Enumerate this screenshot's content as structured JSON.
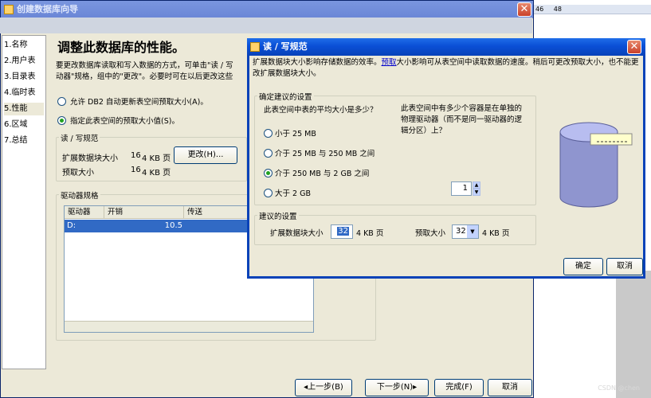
{
  "background": {
    "strip_values": [
      "46",
      "48"
    ],
    "watermark": "CSDN @chen"
  },
  "wizard": {
    "title": "创建数据库向导",
    "nav_items": [
      {
        "num": "1.",
        "label": "名称"
      },
      {
        "num": "2.",
        "label": "用户表"
      },
      {
        "num": "3.",
        "label": "目录表"
      },
      {
        "num": "4.",
        "label": "临时表"
      },
      {
        "num": "5.",
        "label": "性能"
      },
      {
        "num": "6.",
        "label": "区域"
      },
      {
        "num": "7.",
        "label": "总结"
      }
    ],
    "heading": "调整此数据库的性能。",
    "desc_line1": "要更改数据库读取和写入数据的方式，可单击\"读 / 写",
    "desc_line2": "动器\"规格，组中的\"更改\"。必要时可在以后更改这些",
    "radio_auto": "允许 DB2 自动更新表空间预取大小(A)。",
    "radio_specify": "指定此表空间的预取大小值(S)。",
    "rw_group_label": "读 / 写规范",
    "extent_label": "扩展数据块大小",
    "extent_value": "16",
    "extent_unit": "4 KB 页",
    "prefetch_label": "预取大小",
    "prefetch_value": "16",
    "prefetch_unit": "4 KB 页",
    "change_button": "更改(H)...",
    "drive_group_label": "驱动器规格",
    "table_headers": [
      "驱动器",
      "开销",
      "传送"
    ],
    "table_rows": [
      [
        "D:",
        "10.5",
        ""
      ]
    ],
    "back_button": "◂上一步(B)",
    "next_button": "下一步(N)▸",
    "finish_button": "完成(F)",
    "cancel_button": "取消"
  },
  "dialog": {
    "title": "读 / 写规范",
    "info_pre": "扩展数据块大小影响存储数据的效率。",
    "info_link": "预取",
    "info_post": "大小影响可从表空间中读取数据的速度。稍后可更改预取大小，也不能更改扩展数据块大小。",
    "rec_group_label": "确定建议的设置",
    "question1": "此表空间中表的平均大小是多少？",
    "question2": "此表空间中有多少个容器是在单独的物理驱动器（而不是同一驱动器的逻辑分区）上？",
    "size_options": [
      "小于 25 MB",
      "介于 25 MB 与 250 MB 之间",
      "介于 250 MB 与 2 GB 之间",
      "大于 2 GB"
    ],
    "selected_size_index": 2,
    "container_count": "1",
    "suggest_group_label": "建议的设置",
    "extent_label": "扩展数据块大小",
    "extent_value": "32",
    "extent_unit": "4 KB 页",
    "prefetch_label": "预取大小",
    "prefetch_value": "32",
    "prefetch_unit": "4 KB 页",
    "ok_button": "确定",
    "cancel_button": "取消"
  }
}
